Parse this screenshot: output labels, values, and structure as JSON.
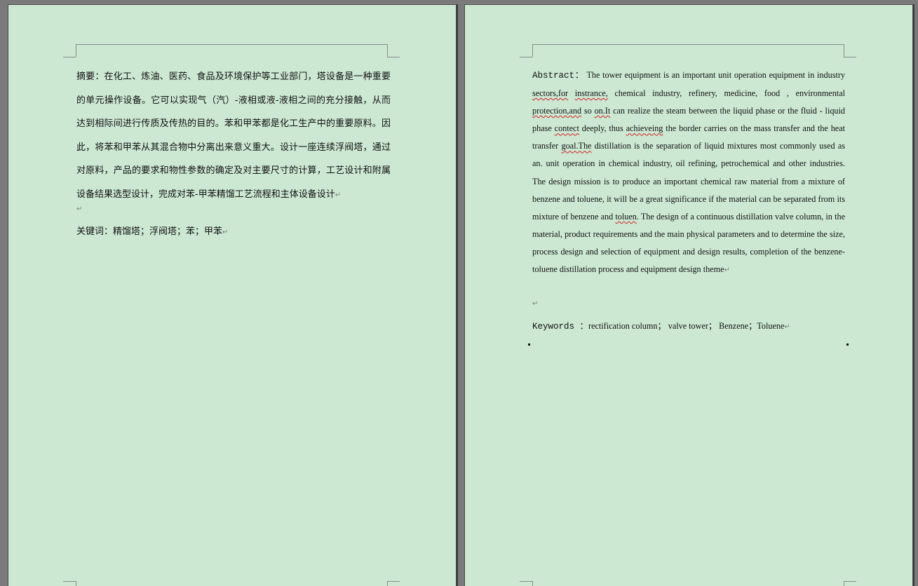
{
  "left_page": {
    "abstract_label": "摘要：",
    "abstract_text": "在化工、炼油、医药、食品及环境保护等工业部门，塔设备是一种重要的单元操作设备。它可以实现气（汽）-液相或液-液相之间的充分接触，从而达到相际间进行传质及传热的目的。苯和甲苯都是化工生产中的重要原料。因此，将苯和甲苯从其混合物中分离出来意义重大。设计一座连续浮阀塔，通过对原料，产品的要求和物性参数的确定及对主要尺寸的计算，工艺设计和附属设备结果选型设计，完成对苯-甲苯精馏工艺流程和主体设备设计",
    "paragraph_mark": "↵",
    "keywords_label": "关键词：",
    "keywords_text": "精馏塔；浮阀塔；苯；甲苯"
  },
  "right_page": {
    "abstract_label": "Abstract：",
    "abstract_segments": [
      {
        "text": " The tower  equipment is an important unit operation equipment in industry ",
        "flag": false
      },
      {
        "text": "sectors,for",
        "flag": true
      },
      {
        "text": " ",
        "flag": false
      },
      {
        "text": "instrance,",
        "flag": true
      },
      {
        "text": " chemical industry, refinery, medicine, food , environmental ",
        "flag": false
      },
      {
        "text": "protection,and",
        "flag": true
      },
      {
        "text": " so ",
        "flag": false
      },
      {
        "text": "on.It",
        "flag": true
      },
      {
        "text": " can realize the steam between the liquid phase or the fluid - liquid phase ",
        "flag": false
      },
      {
        "text": "contect",
        "flag": true
      },
      {
        "text": " deeply, thus ",
        "flag": false
      },
      {
        "text": "achieveing",
        "flag": true
      },
      {
        "text": " the border carries on the mass transfer and the heat transfer ",
        "flag": false
      },
      {
        "text": "goal.The",
        "flag": true
      },
      {
        "text": " distillation is the separation of liquid mixtures most commonly used as an. unit operation in chemical industry, oil refining, petrochemical and other industries. The design mission is to produce an important chemical raw material from a mixture of benzene and toluene, it will be a great significance if the material can be separated from its mixture of benzene and ",
        "flag": false
      },
      {
        "text": "toluen",
        "flag": true
      },
      {
        "text": ". The design of a continuous distillation valve column, in the material, product requirements and the main physical parameters and to determine the size, process design and selection of equipment and design results, completion of the benzene-toluene distillation process and equipment design theme",
        "flag": false
      }
    ],
    "paragraph_mark": "↵",
    "keywords_label": "Keywords ：",
    "keywords_text": "rectification column；  valve tower；  Benzene；Toluene"
  }
}
